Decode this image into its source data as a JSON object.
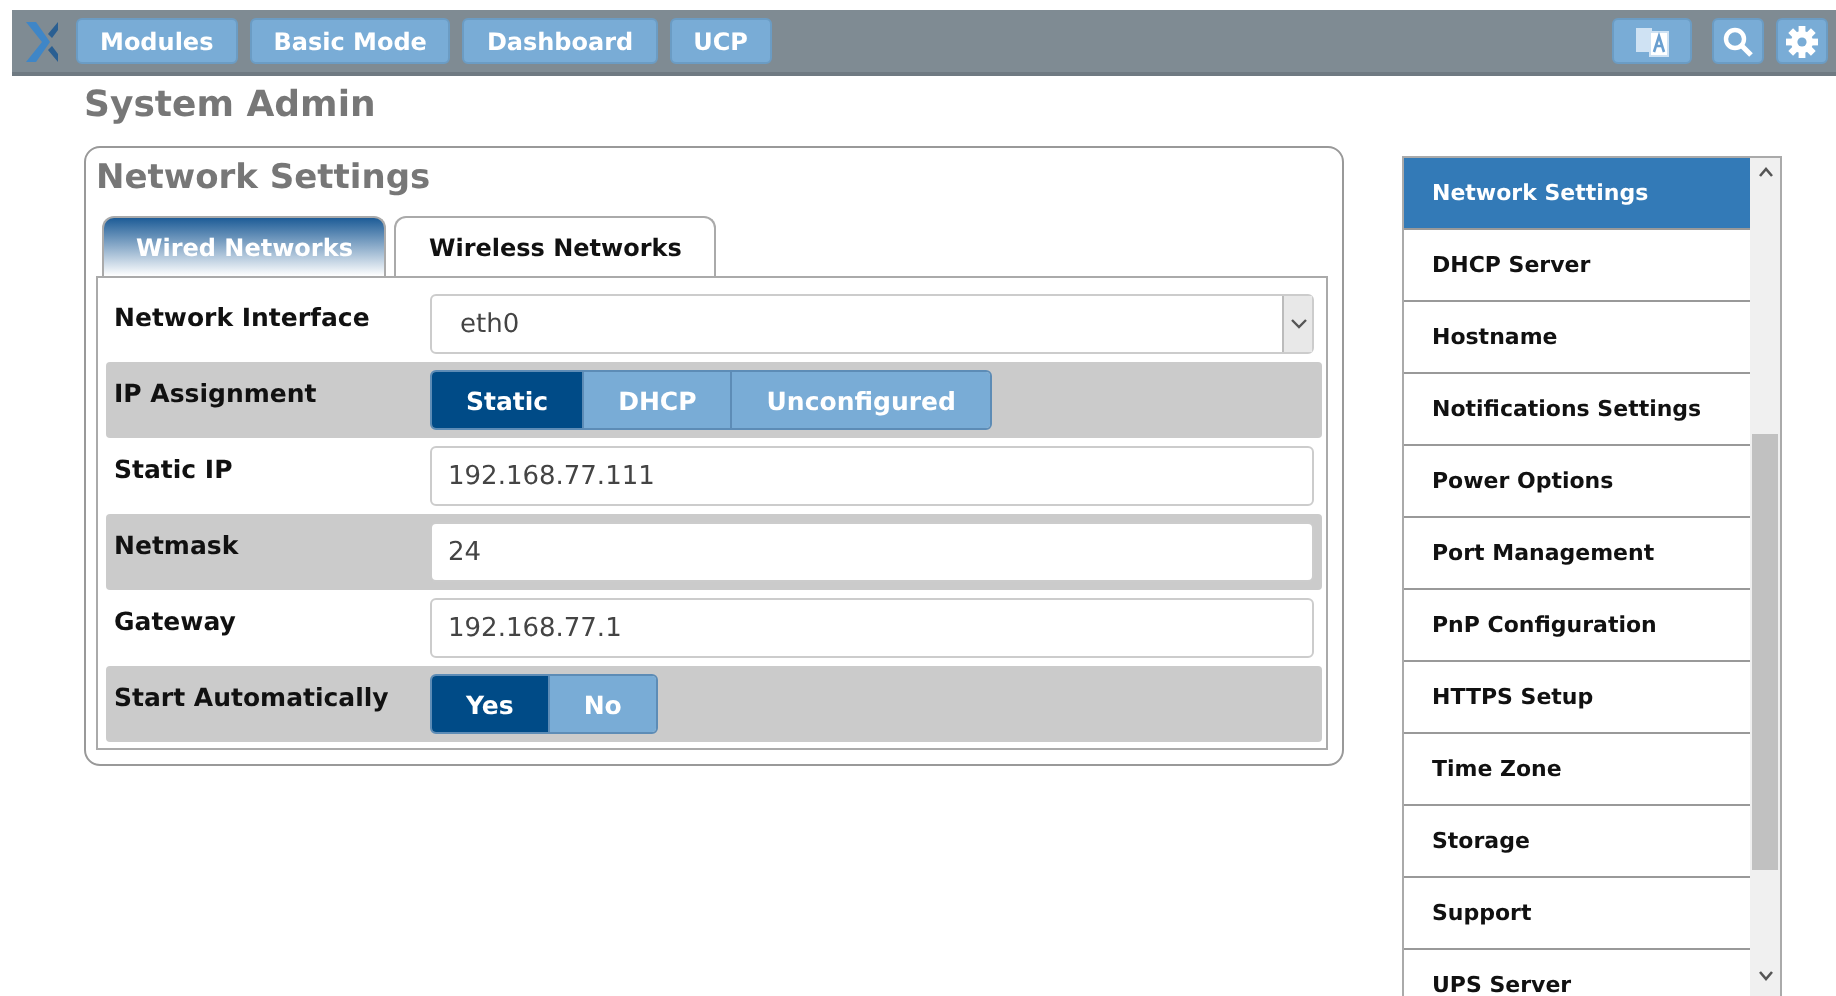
{
  "topbar": {
    "buttons": [
      "Modules",
      "Basic Mode",
      "Dashboard",
      "UCP"
    ]
  },
  "page_title": "System Admin",
  "panel": {
    "title": "Network Settings",
    "tabs": [
      {
        "label": "Wired Networks",
        "selected": true
      },
      {
        "label": "Wireless Networks",
        "selected": false
      }
    ],
    "rows": [
      {
        "kind": "select",
        "label": "Network Interface",
        "value": "eth0"
      },
      {
        "kind": "toggle",
        "label": "IP Assignment",
        "options": [
          {
            "label": "Static",
            "selected": true
          },
          {
            "label": "DHCP",
            "selected": false
          },
          {
            "label": "Unconfigured",
            "selected": false
          }
        ]
      },
      {
        "kind": "text",
        "label": "Static IP",
        "value": "192.168.77.111"
      },
      {
        "kind": "text",
        "label": "Netmask",
        "value": "24"
      },
      {
        "kind": "text",
        "label": "Gateway",
        "value": "192.168.77.1"
      },
      {
        "kind": "toggle",
        "label": "Start Automatically",
        "options": [
          {
            "label": "Yes",
            "selected": true
          },
          {
            "label": "No",
            "selected": false
          }
        ]
      }
    ]
  },
  "sidebar": {
    "items": [
      {
        "label": "Network Settings",
        "selected": true
      },
      {
        "label": "DHCP Server",
        "selected": false
      },
      {
        "label": "Hostname",
        "selected": false
      },
      {
        "label": "Notifications Settings",
        "selected": false
      },
      {
        "label": "Power Options",
        "selected": false
      },
      {
        "label": "Port Management",
        "selected": false
      },
      {
        "label": "PnP Configuration",
        "selected": false
      },
      {
        "label": "HTTPS Setup",
        "selected": false
      },
      {
        "label": "Time Zone",
        "selected": false
      },
      {
        "label": "Storage",
        "selected": false
      },
      {
        "label": "Support",
        "selected": false
      },
      {
        "label": "UPS Server",
        "selected": false
      }
    ]
  }
}
